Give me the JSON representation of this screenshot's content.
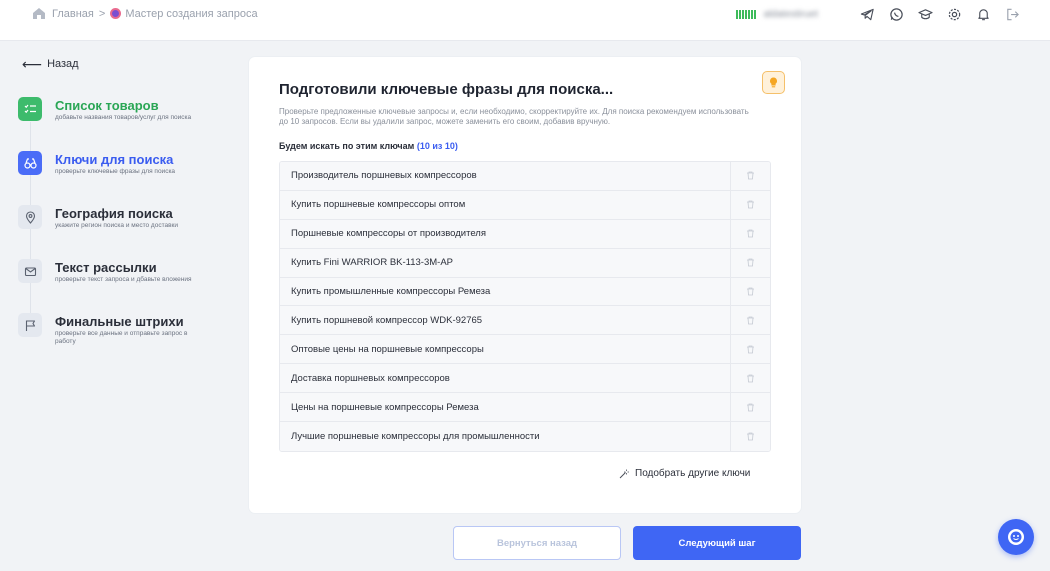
{
  "breadcrumb": {
    "home": "Главная",
    "separator": ">",
    "current": "Мастер создания запроса"
  },
  "header": {
    "user_email": "aldatestiruet"
  },
  "sidebar": {
    "back_label": "Назад",
    "steps": [
      {
        "title": "Список товаров",
        "desc": "добавьте названия товаров/услуг для поиска",
        "state": "done",
        "icon": "checklist-icon"
      },
      {
        "title": "Ключи для поиска",
        "desc": "проверьте ключевые фразы для поиска",
        "state": "active",
        "icon": "binoculars-icon"
      },
      {
        "title": "География поиска",
        "desc": "укажите регион поиска и место доставки",
        "state": "pending",
        "icon": "map-pin-icon"
      },
      {
        "title": "Текст рассылки",
        "desc": "проверьте текст запроса и дбавьте вложения",
        "state": "pending",
        "icon": "envelope-icon"
      },
      {
        "title": "Финальные штрихи",
        "desc": "проверьте все данные и отправьте запрос в работу",
        "state": "pending",
        "icon": "flag-icon"
      }
    ]
  },
  "main": {
    "title": "Подготовили ключевые фразы для поиска...",
    "hint": "Проверьте предложенные ключевые запросы и, если необходимо, скорректируйте их. Для поиска рекомендуем использовать до 10 запросов. Если вы удалили запрос, можете заменить его своим, добавив вручную.",
    "keys_label": "Будем искать по этим ключам",
    "keys_count": "(10 из 10)",
    "keys": [
      "Производитель поршневых компрессоров",
      "Купить поршневые компрессоры оптом",
      "Поршневые компрессоры от производителя",
      "Купить Fini WARRIOR BK-113-3M-AP",
      "Купить промышленные компрессоры Ремеза",
      "Купить поршневой компрессор WDK-92765",
      "Оптовые цены на поршневые компрессоры",
      "Доставка поршневых компрессоров",
      "Цены на поршневые компрессоры Ремеза",
      "Лучшие поршневые компрессоры для промышленности"
    ],
    "pick_more": "Подобрать другие ключи"
  },
  "footer": {
    "back_button": "Вернуться назад",
    "next_button": "Следующий шаг"
  },
  "colors": {
    "accent": "#3f66f4",
    "done": "#3dbb6c",
    "active_text": "#3a5cf0"
  }
}
